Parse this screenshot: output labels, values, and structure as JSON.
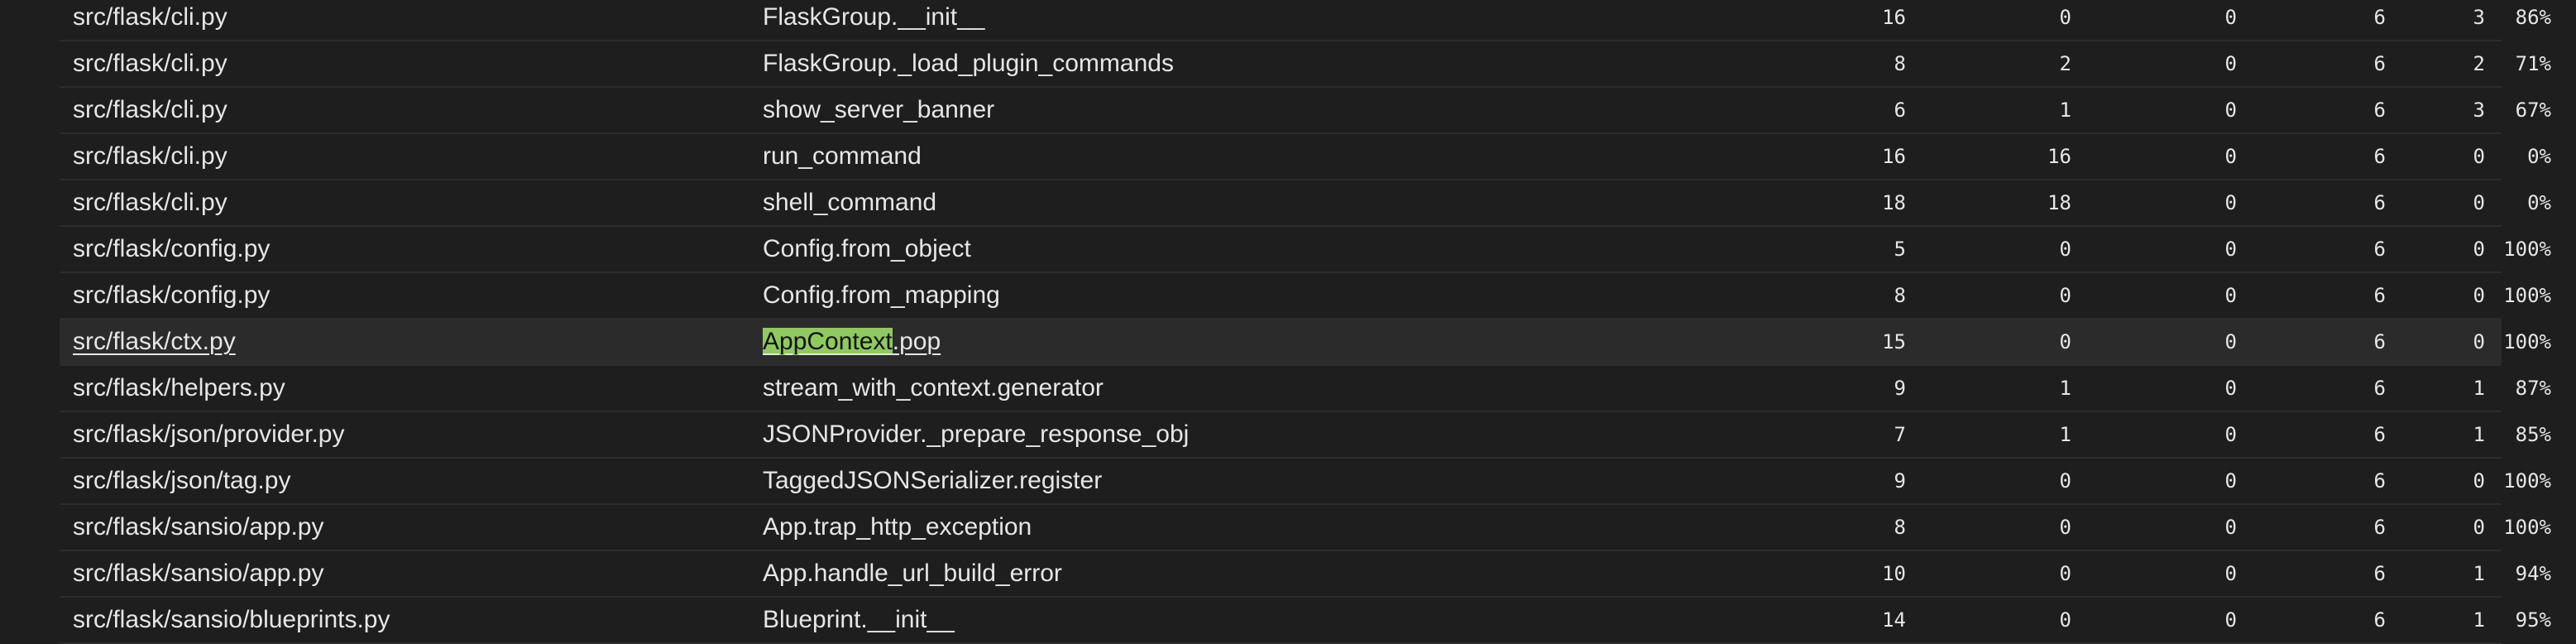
{
  "theme": {
    "background": "#1e1e1e",
    "row_highlight": "#2b2b2b",
    "match_highlight": "#8fc95f",
    "text": "#e6e6e6"
  },
  "rows": [
    {
      "file": "src/flask/cli.py",
      "function": "FlaskGroup.__init__",
      "statements": "16",
      "missing": "0",
      "excluded": "0",
      "branches": "6",
      "partial": "3",
      "coverage": "86%"
    },
    {
      "file": "src/flask/cli.py",
      "function": "FlaskGroup._load_plugin_commands",
      "statements": "8",
      "missing": "2",
      "excluded": "0",
      "branches": "6",
      "partial": "2",
      "coverage": "71%"
    },
    {
      "file": "src/flask/cli.py",
      "function": "show_server_banner",
      "statements": "6",
      "missing": "1",
      "excluded": "0",
      "branches": "6",
      "partial": "3",
      "coverage": "67%"
    },
    {
      "file": "src/flask/cli.py",
      "function": "run_command",
      "statements": "16",
      "missing": "16",
      "excluded": "0",
      "branches": "6",
      "partial": "0",
      "coverage": "0%"
    },
    {
      "file": "src/flask/cli.py",
      "function": "shell_command",
      "statements": "18",
      "missing": "18",
      "excluded": "0",
      "branches": "6",
      "partial": "0",
      "coverage": "0%"
    },
    {
      "file": "src/flask/config.py",
      "function": "Config.from_object",
      "statements": "5",
      "missing": "0",
      "excluded": "0",
      "branches": "6",
      "partial": "0",
      "coverage": "100%"
    },
    {
      "file": "src/flask/config.py",
      "function": "Config.from_mapping",
      "statements": "8",
      "missing": "0",
      "excluded": "0",
      "branches": "6",
      "partial": "0",
      "coverage": "100%"
    },
    {
      "file": "src/flask/ctx.py",
      "function_match": "AppContext",
      "function_rest": ".pop",
      "statements": "15",
      "missing": "0",
      "excluded": "0",
      "branches": "6",
      "partial": "0",
      "coverage": "100%"
    },
    {
      "file": "src/flask/helpers.py",
      "function": "stream_with_context.generator",
      "statements": "9",
      "missing": "1",
      "excluded": "0",
      "branches": "6",
      "partial": "1",
      "coverage": "87%"
    },
    {
      "file": "src/flask/json/provider.py",
      "function": "JSONProvider._prepare_response_obj",
      "statements": "7",
      "missing": "1",
      "excluded": "0",
      "branches": "6",
      "partial": "1",
      "coverage": "85%"
    },
    {
      "file": "src/flask/json/tag.py",
      "function": "TaggedJSONSerializer.register",
      "statements": "9",
      "missing": "0",
      "excluded": "0",
      "branches": "6",
      "partial": "0",
      "coverage": "100%"
    },
    {
      "file": "src/flask/sansio/app.py",
      "function": "App.trap_http_exception",
      "statements": "8",
      "missing": "0",
      "excluded": "0",
      "branches": "6",
      "partial": "0",
      "coverage": "100%"
    },
    {
      "file": "src/flask/sansio/app.py",
      "function": "App.handle_url_build_error",
      "statements": "10",
      "missing": "0",
      "excluded": "0",
      "branches": "6",
      "partial": "1",
      "coverage": "94%"
    },
    {
      "file": "src/flask/sansio/blueprints.py",
      "function": "Blueprint.__init__",
      "statements": "14",
      "missing": "0",
      "excluded": "0",
      "branches": "6",
      "partial": "1",
      "coverage": "95%"
    }
  ]
}
